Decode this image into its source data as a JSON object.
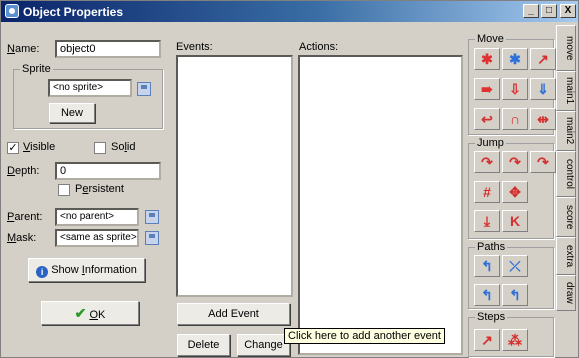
{
  "window": {
    "title": "Object Properties",
    "minimize": "_",
    "maximize": "□",
    "close": "X"
  },
  "left": {
    "name_label": "Name:",
    "name_value": "object0",
    "sprite_group": "Sprite",
    "sprite_value": "<no sprite>",
    "new_button": "New",
    "visible_label": "Visible",
    "visible_checked": true,
    "solid_label": "Solid",
    "solid_checked": false,
    "depth_label": "Depth:",
    "depth_value": "0",
    "persistent_label": "Persistent",
    "persistent_checked": false,
    "parent_label": "Parent:",
    "parent_value": "<no parent>",
    "mask_label": "Mask:",
    "mask_value": "<same as sprite>",
    "show_info_button": "Show Information",
    "ok_button": "OK"
  },
  "events": {
    "label": "Events:",
    "add_event_button": "Add Event",
    "delete_button": "Delete",
    "change_button": "Change"
  },
  "actions": {
    "label": "Actions:"
  },
  "tooltip": "Click here to add another event",
  "palette": {
    "groups": {
      "move": "Move",
      "jump": "Jump",
      "paths": "Paths",
      "steps": "Steps"
    },
    "tabs": [
      "move",
      "main1",
      "main2",
      "control",
      "score",
      "extra",
      "draw"
    ]
  }
}
